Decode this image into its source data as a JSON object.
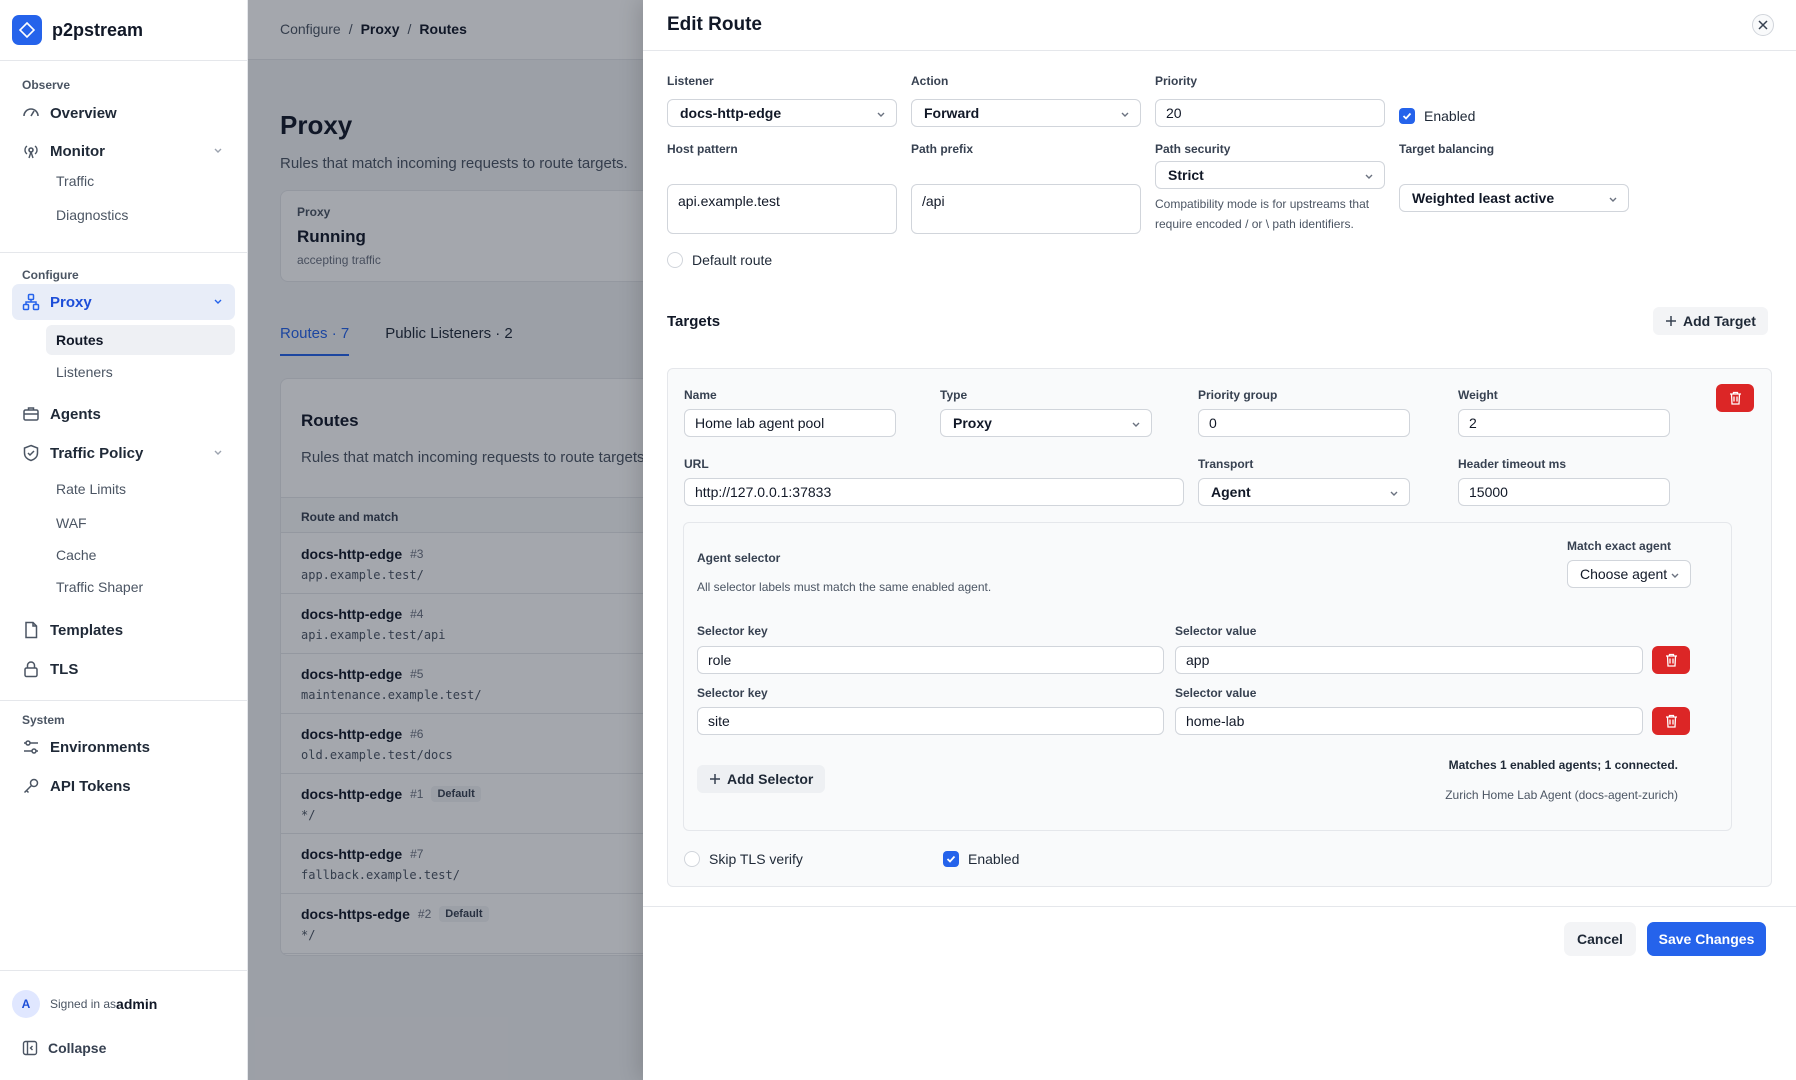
{
  "sidebar": {
    "brand": "p2pstream",
    "groups": {
      "observe": "Observe",
      "configure": "Configure",
      "system": "System"
    },
    "items": {
      "overview": "Overview",
      "monitor": "Monitor",
      "traffic": "Traffic",
      "diagnostics": "Diagnostics",
      "proxy": "Proxy",
      "routes": "Routes",
      "listeners": "Listeners",
      "agents": "Agents",
      "traffic_policy": "Traffic Policy",
      "rate_limits": "Rate Limits",
      "waf": "WAF",
      "cache": "Cache",
      "traffic_shaper": "Traffic Shaper",
      "templates": "Templates",
      "tls": "TLS",
      "environments": "Environments",
      "api_tokens": "API Tokens"
    },
    "user": {
      "initial": "A",
      "prefix": "Signed in as",
      "name": "admin"
    },
    "collapse": "Collapse"
  },
  "breadcrumb": [
    "Configure",
    "Proxy",
    "Routes"
  ],
  "page": {
    "title": "Proxy",
    "description": "Rules that match incoming requests to route targets.",
    "status": {
      "label": "Proxy",
      "value": "Running",
      "sub": "accepting traffic"
    },
    "tabs": [
      "Routes · 7",
      "Public Listeners · 2"
    ],
    "routes": {
      "title": "Routes",
      "description": "Rules that match incoming requests to route targets.",
      "column": "Route and match",
      "rows": [
        {
          "name": "docs-http-edge",
          "num": "#3",
          "match": "app.example.test/",
          "badge": ""
        },
        {
          "name": "docs-http-edge",
          "num": "#4",
          "match": "api.example.test/api",
          "badge": ""
        },
        {
          "name": "docs-http-edge",
          "num": "#5",
          "match": "maintenance.example.test/",
          "badge": ""
        },
        {
          "name": "docs-http-edge",
          "num": "#6",
          "match": "old.example.test/docs",
          "badge": ""
        },
        {
          "name": "docs-http-edge",
          "num": "#1",
          "match": "*/",
          "badge": "Default"
        },
        {
          "name": "docs-http-edge",
          "num": "#7",
          "match": "fallback.example.test/",
          "badge": ""
        },
        {
          "name": "docs-https-edge",
          "num": "#2",
          "match": "*/",
          "badge": "Default"
        }
      ]
    }
  },
  "panel": {
    "title": "Edit Route",
    "listener": {
      "label": "Listener",
      "value": "docs-http-edge"
    },
    "action": {
      "label": "Action",
      "value": "Forward"
    },
    "priority": {
      "label": "Priority",
      "value": "20"
    },
    "enabled": {
      "label": "Enabled",
      "checked": true
    },
    "host_pattern": {
      "label": "Host pattern",
      "value": "api.example.test"
    },
    "path_prefix": {
      "label": "Path prefix",
      "value": "/api"
    },
    "path_security": {
      "label": "Path security",
      "value": "Strict",
      "hint": "Compatibility mode is for upstreams that require encoded / or \\ path identifiers."
    },
    "target_balancing": {
      "label": "Target balancing",
      "value": "Weighted least active"
    },
    "default_route": {
      "label": "Default route",
      "checked": false
    },
    "targets": {
      "title": "Targets",
      "add_label": "Add Target",
      "target": {
        "name": {
          "label": "Name",
          "value": "Home lab agent pool"
        },
        "type": {
          "label": "Type",
          "value": "Proxy"
        },
        "priority_group": {
          "label": "Priority group",
          "value": "0"
        },
        "weight": {
          "label": "Weight",
          "value": "2"
        },
        "url": {
          "label": "URL",
          "value": "http://127.0.0.1:37833"
        },
        "transport": {
          "label": "Transport",
          "value": "Agent"
        },
        "header_timeout": {
          "label": "Header timeout ms",
          "value": "15000"
        },
        "agent_selector": {
          "title": "Agent selector",
          "description": "All selector labels must match the same enabled agent.",
          "match_exact_label": "Match exact agent",
          "match_exact_value": "Choose agent",
          "key_label": "Selector key",
          "value_label": "Selector value",
          "selectors": [
            {
              "key": "role",
              "value": "app"
            },
            {
              "key": "site",
              "value": "home-lab"
            }
          ],
          "add_label": "Add Selector",
          "match_summary": "Matches 1 enabled agents; 1 connected.",
          "match_agent": "Zurich Home Lab Agent (docs-agent-zurich)"
        },
        "skip_tls": {
          "label": "Skip TLS verify",
          "checked": false
        },
        "enabled": {
          "label": "Enabled",
          "checked": true
        }
      }
    },
    "cancel_label": "Cancel",
    "save_label": "Save Changes"
  },
  "colors": {
    "accent": "#2563eb",
    "danger": "#dc2626",
    "overlay": "rgba(17,24,39,0.38)"
  }
}
